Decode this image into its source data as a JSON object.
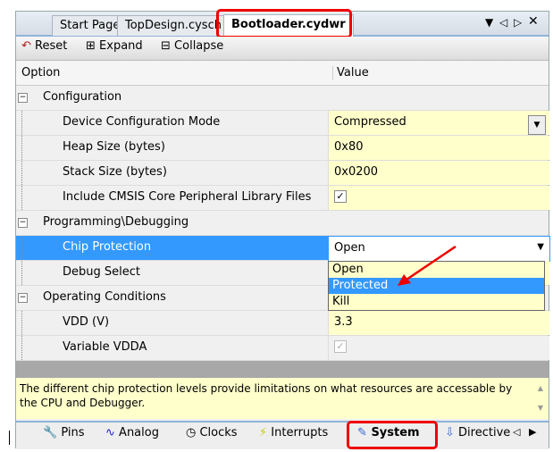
{
  "tabs": [
    "Start Page",
    "TopDesign.cysch",
    "Bootloader.cydwr"
  ],
  "toolbar": {
    "reset": "Reset",
    "expand": "Expand",
    "collapse": "Collapse"
  },
  "header": {
    "option": "Option",
    "value": "Value"
  },
  "rows": [
    {
      "label": "Configuration"
    },
    {
      "label": "Device Configuration Mode",
      "value": "Compressed"
    },
    {
      "label": "Heap Size (bytes)",
      "value": "0x80"
    },
    {
      "label": "Stack Size (bytes)",
      "value": "0x0200"
    },
    {
      "label": "Include CMSIS Core Peripheral Library Files",
      "checked": true
    },
    {
      "label": "Programming\\Debugging"
    },
    {
      "label": "Chip Protection",
      "value": "Open"
    },
    {
      "label": "Debug Select",
      "value": ""
    },
    {
      "label": "Operating Conditions"
    },
    {
      "label": "VDD (V)",
      "value": "3.3"
    },
    {
      "label": "Variable VDDA",
      "checked": true
    }
  ],
  "dropdown": {
    "options": [
      "Open",
      "Protected",
      "Kill"
    ],
    "highlighted": "Protected"
  },
  "description": "The different chip protection levels provide limitations on what resources are accessable by the CPU and Debugger.",
  "bottom_tabs": [
    "Pins",
    "Analog",
    "Clocks",
    "Interrupts",
    "System",
    "Directive"
  ]
}
